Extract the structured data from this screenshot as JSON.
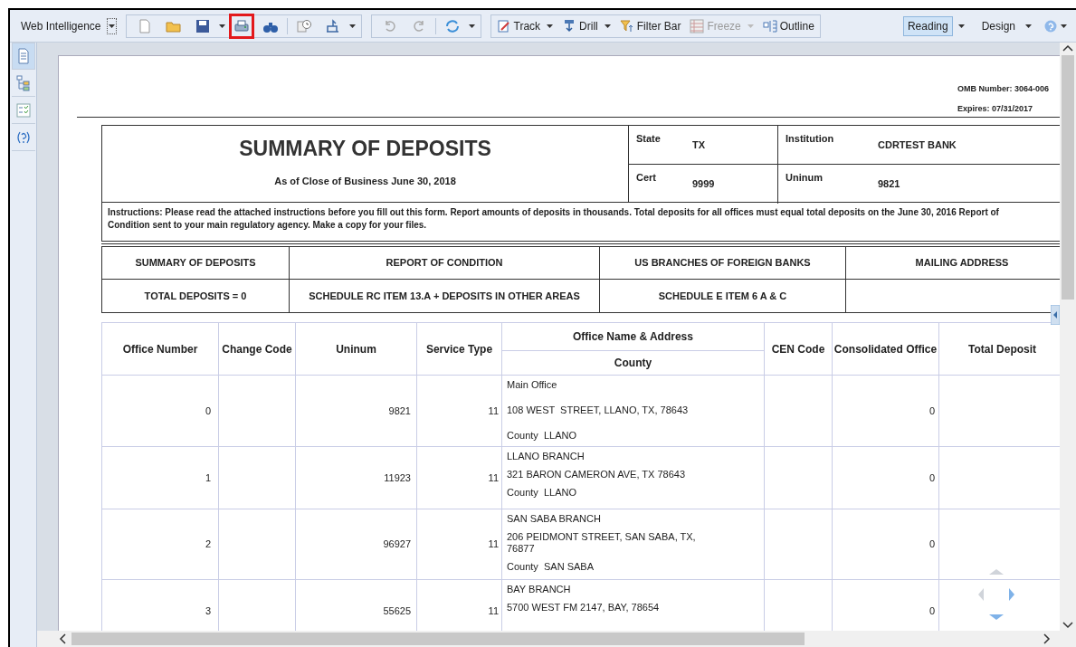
{
  "toolbar": {
    "app_menu": "Web Intelligence",
    "icon_tools": [
      {
        "highlighted": false
      },
      {
        "highlighted": false
      },
      {
        "highlighted": false
      },
      {
        "highlighted": true
      },
      {
        "highlighted": false
      },
      {
        "highlighted": false
      },
      {
        "highlighted": false
      },
      {
        "highlighted": false
      },
      {
        "highlighted": false
      },
      {
        "highlighted": false
      }
    ],
    "text_tools": [
      {
        "label": "Track",
        "dropdown": true,
        "disabled": false
      },
      {
        "label": "Drill",
        "dropdown": true,
        "disabled": false
      },
      {
        "label": "Filter Bar",
        "dropdown": false,
        "disabled": false
      },
      {
        "label": "Freeze",
        "dropdown": true,
        "disabled": true
      },
      {
        "label": "Outline",
        "dropdown": false,
        "disabled": false
      }
    ],
    "modes": [
      {
        "label": "Reading",
        "selected": true
      },
      {
        "label": "Design",
        "selected": false
      }
    ]
  },
  "side_panel": [
    {
      "selected": true
    },
    {
      "selected": false
    },
    {
      "selected": false
    },
    {
      "selected": false
    }
  ],
  "report": {
    "omb_number": "OMB Number: 3064-006",
    "expires": "Expires: 07/31/2017",
    "title": "SUMMARY OF DEPOSITS",
    "subtitle": "As of Close of Business June 30, 2018",
    "fields": [
      {
        "label": "State",
        "value": "TX"
      },
      {
        "label": "Institution",
        "value": "CDRTEST BANK"
      },
      {
        "label": "Cert",
        "value": "9999"
      },
      {
        "label": "Uninum",
        "value": "9821"
      }
    ],
    "instructions": "Instructions: Please read the attached instructions before you fill out this form. Report amounts of deposits in thousands. Total deposits for all offices must equal total deposits on the June 30, 2016 Report of Condition sent to your main regulatory agency. Make a copy for your files.",
    "reference": {
      "headers": [
        "SUMMARY OF DEPOSITS",
        "REPORT OF CONDITION",
        "US BRANCHES OF FOREIGN BANKS",
        "MAILING ADDRESS"
      ],
      "values": [
        "TOTAL DEPOSITS = 0",
        "SCHEDULE RC ITEM 13.A + DEPOSITS IN OTHER AREAS",
        "SCHEDULE E ITEM 6 A & C"
      ]
    },
    "table": {
      "columns": [
        "Office Number",
        "Change Code",
        "Uninum",
        "Service Type",
        "Office Name & Address",
        "County",
        "CEN Code",
        "Consolidated Office",
        "Total Deposit"
      ],
      "rows": [
        {
          "office_number": "0",
          "uninum": "9821",
          "service_type": "11",
          "name": "Main Office",
          "address": "108 WEST  STREET, LLANO, TX, 78643",
          "county": "County  LLANO",
          "consolidated": "0"
        },
        {
          "office_number": "1",
          "uninum": "11923",
          "service_type": "11",
          "name": "LLANO BRANCH",
          "address": "321 BARON CAMERON AVE, TX 78643",
          "county": "County  LLANO",
          "consolidated": "0"
        },
        {
          "office_number": "2",
          "uninum": "96927",
          "service_type": "11",
          "name": "SAN SABA BRANCH",
          "address": "206 PEIDMONT STREET, SAN SABA, TX, 76877",
          "county": "County  SAN SABA",
          "consolidated": "0"
        },
        {
          "office_number": "3",
          "uninum": "55625",
          "service_type": "11",
          "name": "BAY BRANCH",
          "address": "5700 WEST FM 2147, BAY, 78654",
          "consolidated": "0"
        }
      ]
    }
  }
}
